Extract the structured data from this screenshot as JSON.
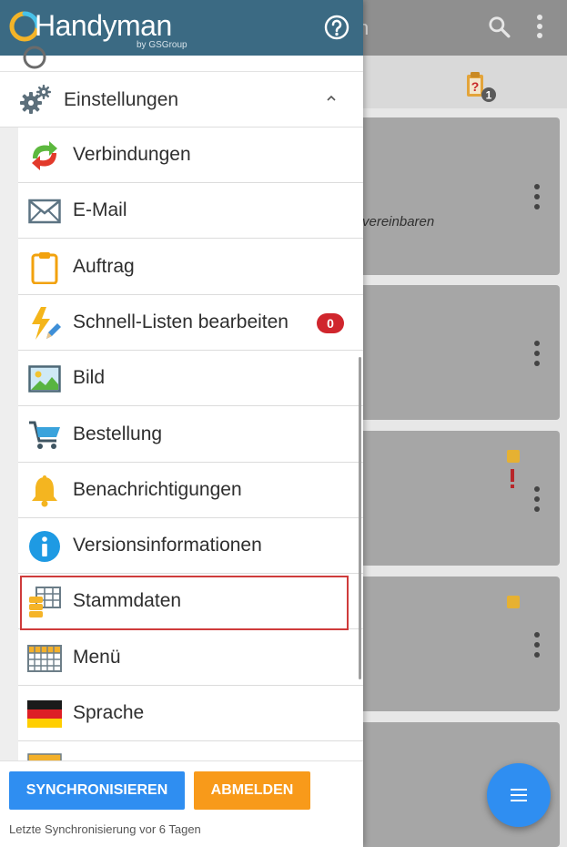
{
  "background": {
    "title_fragment": "n",
    "tab_badge_count": "1",
    "card_text": "vereinbaren"
  },
  "drawer": {
    "logo": {
      "name": "Handyman",
      "sub": "by GSGroup"
    },
    "section": {
      "label": "Einstellungen"
    },
    "items": [
      {
        "label": "Verbindungen",
        "icon": "connections-icon"
      },
      {
        "label": "E-Mail",
        "icon": "email-icon"
      },
      {
        "label": "Auftrag",
        "icon": "clipboard-icon"
      },
      {
        "label": "Schnell-Listen bearbeiten",
        "icon": "quick-list-edit-icon",
        "badge": "0"
      },
      {
        "label": "Bild",
        "icon": "image-icon"
      },
      {
        "label": "Bestellung",
        "icon": "shopping-cart-icon"
      },
      {
        "label": "Benachrichtigungen",
        "icon": "bell-icon"
      },
      {
        "label": "Versionsinformationen",
        "icon": "info-icon"
      },
      {
        "label": "Stammdaten",
        "icon": "master-data-icon",
        "highlighted": true
      },
      {
        "label": "Menü",
        "icon": "menu-grid-icon"
      },
      {
        "label": "Sprache",
        "icon": "german-flag-icon"
      }
    ],
    "footer": {
      "sync_label": "SYNCHRONISIEREN",
      "logout_label": "ABMELDEN",
      "sync_status": "Letzte Synchronisierung vor 6 Tagen"
    }
  },
  "colors": {
    "header": "#3b6a83",
    "primary": "#2f8ef1",
    "accent": "#f89a1a",
    "badge": "#d0262d",
    "highlight": "#cf3b3b"
  }
}
